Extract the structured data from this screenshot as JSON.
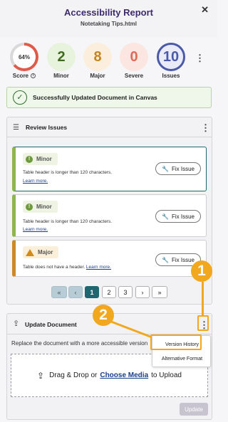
{
  "header": {
    "title": "Accessibility Report",
    "filename": "Notetaking Tips.html",
    "close_icon": "close-icon"
  },
  "summary": {
    "score": {
      "value": "64%",
      "label": "Score",
      "fraction": 0.64,
      "color": "#e05a4a"
    },
    "minor": {
      "value": "2",
      "label": "Minor",
      "color": "#5b8a2c"
    },
    "major": {
      "value": "8",
      "label": "Major",
      "color": "#d48a18"
    },
    "severe": {
      "value": "0",
      "label": "Severe",
      "color": "#e05a4a"
    },
    "issues": {
      "value": "10",
      "label": "Issues",
      "color": "#4a5aa8"
    },
    "more_icon": "kebab-icon"
  },
  "success_banner": {
    "text": "Successfully Updated Document in Canvas",
    "icon": "check-circle-icon"
  },
  "review_panel": {
    "title": "Review Issues",
    "issues": [
      {
        "severity": "Minor",
        "description": "Table header is longer than 120 characters.",
        "learn_more": "Learn more.",
        "fix_label": "Fix Issue"
      },
      {
        "severity": "Minor",
        "description": "Table header is longer than 120 characters.",
        "learn_more": "Learn more.",
        "fix_label": "Fix Issue"
      },
      {
        "severity": "Major",
        "description": "Table does not have a header.",
        "learn_more": "Learn more.",
        "fix_label": "Fix Issue"
      }
    ],
    "pagination": {
      "first": "«",
      "prev": "‹",
      "pages": [
        "1",
        "2",
        "3"
      ],
      "current": "1",
      "next": "›",
      "last": "»"
    }
  },
  "update_panel": {
    "title": "Update Document",
    "description": "Replace the document with a more accessible version",
    "drop_text_before": "Drag & Drop or",
    "drop_link": "Choose Media",
    "drop_text_after": "to Upload",
    "update_button": "Update"
  },
  "dropdown_menu": {
    "items": [
      "Version History",
      "Alternative Format"
    ]
  },
  "annotations": {
    "marker_1": "1",
    "marker_2": "2",
    "color": "#f2a81e"
  }
}
